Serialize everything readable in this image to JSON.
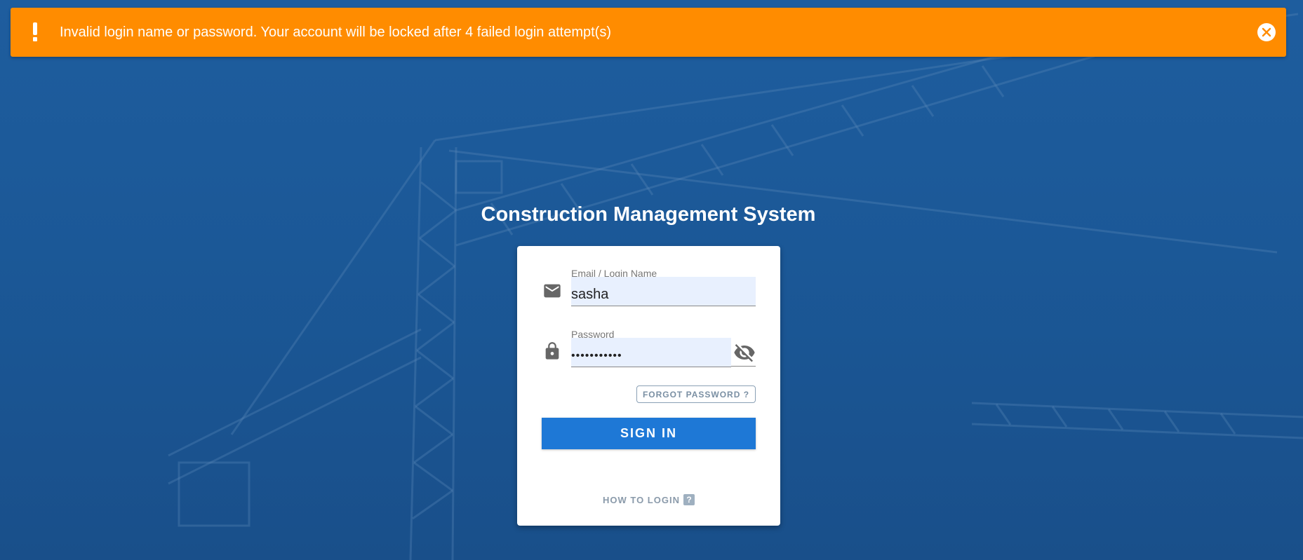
{
  "alert": {
    "icon": "exclamation-icon",
    "message": "Invalid login name or password. Your account will be locked after 4 failed login attempt(s)",
    "close_icon": "close-circle-icon",
    "color": "#ff8c00"
  },
  "app": {
    "title": "Construction Management System"
  },
  "login_form": {
    "email": {
      "icon": "envelope-icon",
      "label": "Email / Login Name",
      "value": "sasha"
    },
    "password": {
      "icon": "lock-icon",
      "label": "Password",
      "value": "•••••••••••",
      "toggle_icon": "eye-off-icon"
    },
    "forgot_password_label": "FORGOT PASSWORD ?",
    "sign_in_label": "SIGN IN",
    "how_to_login_label": "HOW TO LOGIN",
    "help_icon": "?"
  },
  "colors": {
    "background": "#1d5a9a",
    "primary_button": "#1e78d6",
    "input_fill": "#e8f0fe"
  }
}
